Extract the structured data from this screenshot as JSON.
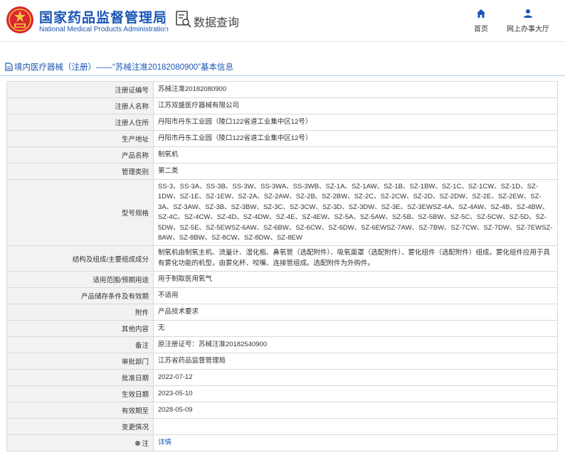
{
  "header": {
    "org_cn": "国家药品监督管理局",
    "org_en": "National Medical Products Administration",
    "section": "数据查询",
    "nav_home": "首页",
    "nav_office": "网上办事大厅",
    "brand_color": "#1a56b4"
  },
  "title_bar": {
    "text": "境内医疗器械（注册）——“苏械注准20182080900”基本信息"
  },
  "rows": [
    {
      "label": "注册证编号",
      "value": "苏械注准20182080900"
    },
    {
      "label": "注册人名称",
      "value": "江苏双盛医疗器械有限公司"
    },
    {
      "label": "注册人住所",
      "value": "丹阳市丹东工业园（陵口122省道工业集中区12号）"
    },
    {
      "label": "生产地址",
      "value": "丹阳市丹东工业园（陵口122省道工业集中区12号）"
    },
    {
      "label": "产品名称",
      "value": "制氧机"
    },
    {
      "label": "管理类别",
      "value": "第二类"
    },
    {
      "label": "型号规格",
      "value": "SS-3、SS-3A、SS-3B、SS-3W、SS-3WA、SS-3WB、SZ-1A、SZ-1AW、SZ-1B、SZ-1BW、SZ-1C、SZ-1CW、SZ-1D、SZ-1DW、SZ-1E、SZ-1EW、SZ-2A、SZ-2AW、SZ-2B、SZ-2BW、SZ-2C、SZ-2CW、SZ-2D、SZ-2DW、SZ-2E、SZ-2EW、SZ-3A、SZ-3AW、SZ-3B、SZ-3BW、SZ-3C、SZ-3CW、SZ-3D、SZ-3DW、SZ-3E、SZ-3EWSZ-4A、SZ-4AW、SZ-4B、SZ-4BW、SZ-4C、SZ-4CW、SZ-4D、SZ-4DW、SZ-4E、SZ-4EW、SZ-5A、SZ-5AW、SZ-5B、SZ-5BW、SZ-5C、SZ-5CW、SZ-5D、SZ-5DW、SZ-5E、SZ-5EWSZ-6AW、SZ-6BW、SZ-6CW、SZ-6DW、SZ-6EWSZ-7AW、SZ-7BW、SZ-7CW、SZ-7DW、SZ-7EWSZ-8AW、SZ-8BW、SZ-8CW、SZ-8DW、SZ-8EW"
    },
    {
      "label": "结构及组成/主要组成成分",
      "value": "制氧机由制氧主机、流量计、湿化瓶、鼻氧管（选配附件）、吸氧面罩（选配附件）、雾化组件（选配附件）组成。雾化组件应用于具有雾化功能的机型，由雾化杯、咬嘴、连接管组成。选配附件为外购件。"
    },
    {
      "label": "适用范围/预期用途",
      "value": "用于制取医用氧气"
    },
    {
      "label": "产品储存条件及有效期",
      "value": "不适用"
    },
    {
      "label": "附件",
      "value": "产品技术要求"
    },
    {
      "label": "其他内容",
      "value": "无"
    },
    {
      "label": "备注",
      "value": "原注册证号：苏械注准20182540900"
    },
    {
      "label": "审批部门",
      "value": "江苏省药品监督管理局"
    },
    {
      "label": "批准日期",
      "value": "2022-07-12"
    },
    {
      "label": "生效日期",
      "value": "2023-05-10"
    },
    {
      "label": "有效期至",
      "value": "2028-05-09"
    },
    {
      "label": "变更情况",
      "value": ""
    }
  ],
  "note": {
    "label": "注",
    "link": "详情",
    "icon": "bulb-icon"
  }
}
